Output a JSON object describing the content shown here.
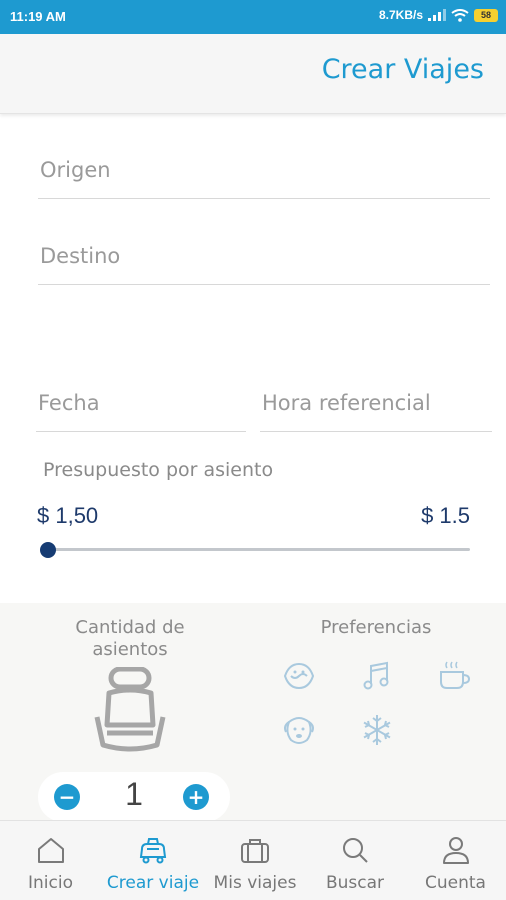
{
  "status_bar": {
    "time": "11:19 AM",
    "network_speed": "8.7KB/s",
    "battery": "58"
  },
  "header": {
    "title": "Crear Viajes"
  },
  "form": {
    "origin_label": "Origen",
    "destination_label": "Destino",
    "date_label": "Fecha",
    "time_label": "Hora referencial"
  },
  "budget": {
    "label": "Presupuesto por asiento",
    "min_value": "$ 1,50",
    "max_value": "$ 1.5",
    "slider_fraction": 0
  },
  "seats": {
    "title": "Cantidad de asientos",
    "count": "1",
    "decrement": "−",
    "increment": "+"
  },
  "preferences": {
    "title": "Preferencias",
    "icons": [
      "smoking-icon",
      "music-icon",
      "coffee-icon",
      "pet-icon",
      "air-conditioning-icon"
    ]
  },
  "nav": {
    "items": [
      {
        "label": "Inicio",
        "icon": "home-icon",
        "active": false
      },
      {
        "label": "Crear viaje",
        "icon": "car-icon",
        "active": true
      },
      {
        "label": "Mis viajes",
        "icon": "briefcase-icon",
        "active": false
      },
      {
        "label": "Buscar",
        "icon": "search-icon",
        "active": false
      },
      {
        "label": "Cuenta",
        "icon": "user-icon",
        "active": false
      }
    ]
  },
  "colors": {
    "accent": "#1e9ad0",
    "dark_blue": "#163c73",
    "muted_icon": "#a9c9de"
  }
}
